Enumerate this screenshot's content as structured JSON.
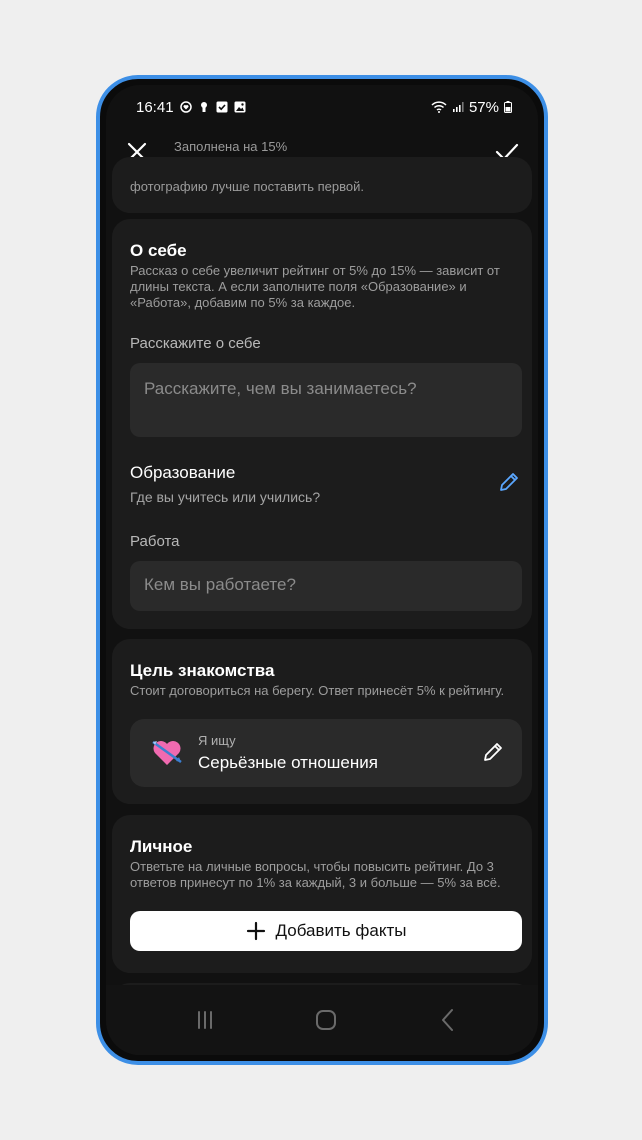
{
  "status_bar": {
    "time": "16:41",
    "battery": "57%",
    "icons": [
      "heart-notification-icon",
      "keyhole-icon",
      "check-box-icon",
      "image-icon",
      "wifi-icon",
      "signal-icon",
      "battery-icon"
    ]
  },
  "top_bar": {
    "progress_label": "Заполнена на 15%",
    "progress_fraction": 0.15,
    "progress_color": "#e8404a",
    "close_icon": "close-icon",
    "confirm_icon": "check-icon"
  },
  "photo_section": {
    "hint_tail": "фотографию лучше поставить первой."
  },
  "about_section": {
    "title": "О себе",
    "description": "Рассказ о себе увеличит рейтинг от 5% до 15% — зависит от длины текста. А если заполните поля «Образование» и «Работа», добавим по 5% за каждое.",
    "about_label": "Расскажите о себе",
    "about_placeholder": "Расскажите, чем вы занимаетесь?",
    "education_title": "Образование",
    "education_desc": "Где вы учитесь или учились?",
    "work_label": "Работа",
    "work_placeholder": "Кем вы работаете?"
  },
  "goal_section": {
    "title": "Цель знакомства",
    "description": "Стоит договориться на берегу. Ответ принесёт 5% к рейтингу.",
    "looking_for_label": "Я ищу",
    "looking_for_value": "Серьёзные отношения"
  },
  "personal_section": {
    "title": "Личное",
    "description": "Ответьте на личные вопросы, чтобы повысить рейтинг. До 3 ответов принесут по 1% за каждый, 3 и больше — 5% за всё.",
    "add_button_label": "Добавить факты"
  },
  "nav_bar": {
    "buttons": [
      "recent-apps-icon",
      "home-icon",
      "back-icon"
    ]
  },
  "colors": {
    "frame": "#3d8fe6",
    "background": "#111111",
    "card": "#1c1c1c",
    "input": "#2a2a2a",
    "edit_accent": "#5aa7ff"
  }
}
